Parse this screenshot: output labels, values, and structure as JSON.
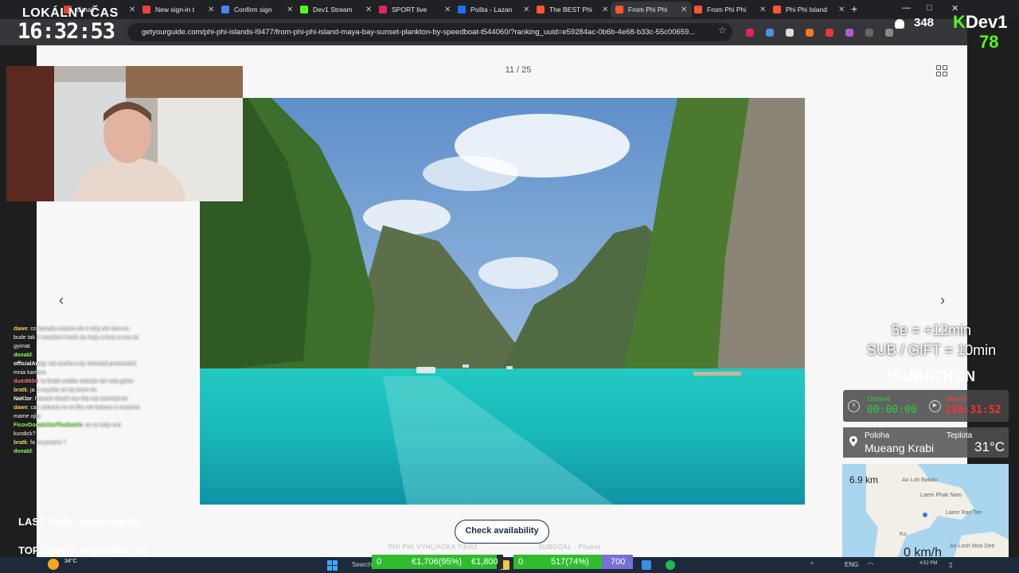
{
  "browser": {
    "tabs": [
      {
        "label": "Gmail",
        "fav": "#ea4335"
      },
      {
        "label": "New sign-in t",
        "fav": "#ea4335"
      },
      {
        "label": "Confirm sign",
        "fav": "#4285f4"
      },
      {
        "label": "Dev1 Stream",
        "fav": "#53fc18"
      },
      {
        "label": "SPORT live",
        "fav": "#e0245e"
      },
      {
        "label": "Pošta - Lazan",
        "fav": "#1a73e8"
      },
      {
        "label": "The BEST Phi",
        "fav": "#ff5533"
      },
      {
        "label": "From Phi Phi",
        "fav": "#ff5533",
        "active": true
      },
      {
        "label": "From Phi Phi",
        "fav": "#ff5533"
      },
      {
        "label": "Phi Phi Island",
        "fav": "#ff5533"
      }
    ],
    "new_tab": "+",
    "window_controls": {
      "minimize": "—",
      "restore": "□",
      "close": "✕"
    },
    "url": "getyourguide.com/phi-phi-islands-l9477/from-phi-phi-island-maya-bay-sunset-plankton-by-speedboat-t544060/?ranking_uuid=e59284ac-0b6b-4e68-b33c-55c00659..."
  },
  "gallery": {
    "counter": "11 / 25",
    "prev_arrow": "‹",
    "next_arrow": "›",
    "cta": "Check availability"
  },
  "overlay": {
    "clock_label": "LOKÁLNY ČAS",
    "clock_time": "16:32:53",
    "viewers": "348",
    "brand_k": "K",
    "brand_name": "Dev1",
    "brand_number": "78",
    "rule1": "5e = +12min",
    "rule2": "SUB / GIFT = 10min",
    "subathon": "!SUBATHON",
    "timer": {
      "left_label": "Ostáva",
      "left_value": "00:00:00",
      "right_label": "Ideme",
      "right_value": "238:31:52"
    },
    "location": {
      "label": "Poloha",
      "value": "Mueang Krabi",
      "temp_label": "Teplota",
      "temp_value": "31°C"
    },
    "map": {
      "distance": "6.9 km",
      "speed": "0 km/h",
      "places": [
        "Ao Loh Bakao",
        "Laem Phak Nam",
        "Laem Ran Tee",
        "Ko",
        "Ao Lonh Moo Dee"
      ]
    },
    "last_sub_label": "LAST SUB:",
    "last_sub_value": "skinyman44",
    "top_dono": "TOP DONO: majkelthe - €5",
    "goal_label_1": "PHI PHI VYHLIADKA TIERZ",
    "goal_label_2": "SUBGOAL - Phuket",
    "goal_bar_1": {
      "start": "0",
      "middle": "€1,706(95%)",
      "end": "€1,800",
      "progress": 0.95
    },
    "goal_bar_2": {
      "start": "0",
      "middle": "517(74%)",
      "end": "700",
      "progress": 0.74
    }
  },
  "chat": [
    {
      "user": "dawe",
      "text": ": co kanada mozem do 4 roky ale isto mu bude tak 2 maudom hrach ze maju s kurz a vsa na gyimat"
    },
    {
      "user": "donald",
      "text": ":"
    },
    {
      "user": "officialAway",
      "text": ": tak arotka a by slimulsd premiestnil mnia kamera"
    },
    {
      "user": "dum9604",
      "text": ": tu finale uvidite sebude tak vela golov"
    },
    {
      "user": "bratk",
      "text": ": ja si myslim ze tej verim im"
    },
    {
      "user": "NaKlor",
      "text": ": hracom Musili ma ritta raz autorizovat"
    },
    {
      "user": "dawe",
      "text": ": cak zobrnes to co libe od mekace a sviatove mame ojiju"
    },
    {
      "user": "FicovDonateVarPluskovin",
      "text": ": co ce tady reci kundick?"
    },
    {
      "user": "bratk",
      "text": ": fa na pozera ?"
    },
    {
      "user": "donald",
      "text": ":"
    }
  ],
  "taskbar": {
    "weather": "34°C",
    "search": "Search",
    "lang": "ENG",
    "time": "4:52 PM"
  }
}
